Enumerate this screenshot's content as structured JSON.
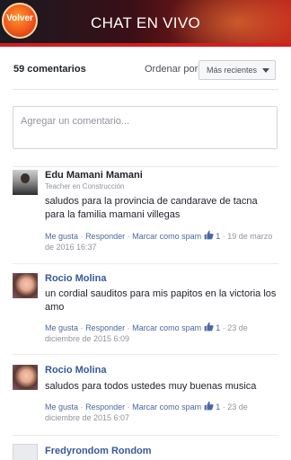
{
  "header": {
    "back_label": "Volver",
    "title": "CHAT EN VIVO"
  },
  "toolbar": {
    "count_label": "59 comentarios",
    "order_label": "Ordenar por",
    "order_value": "Más recientes"
  },
  "composer": {
    "placeholder": "Agregar un comentario..."
  },
  "actions": {
    "like": "Me gusta",
    "reply": "Responder",
    "spam": "Marcar como spam",
    "dot": "·"
  },
  "comments": [
    {
      "name": "Edu Mamani Mamani",
      "subtitle": "Teacher en Construcción",
      "text": "saludos para la provincia de candarave de tacna para la familia mamani villegas",
      "likes": "1",
      "date": "19 de marzo de 2016 16:37"
    },
    {
      "name": "Rocio Molina",
      "text": "un cordial sauditos para mis papitos en la victoria los amo",
      "likes": "1",
      "date": "23 de diciembre de 2015 6:09"
    },
    {
      "name": "Rocio Molina",
      "text": "saludos para todos ustedes muy buenas musica",
      "likes": "1",
      "date": "23 de diciembre de 2015 6:07"
    },
    {
      "name": "Fredyrondom Rondom"
    }
  ]
}
